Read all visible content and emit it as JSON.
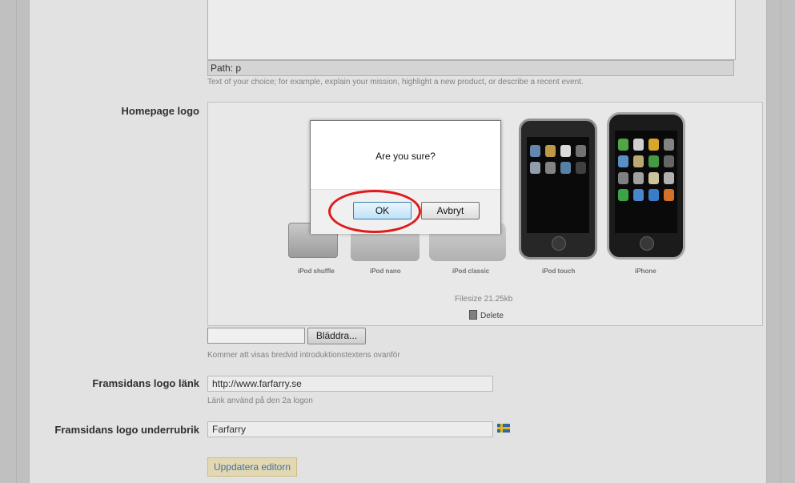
{
  "editor": {
    "path_text": "Path: p",
    "hint": "Text of your choice; for example, explain your mission, highlight a new product, or describe a recent event."
  },
  "homepage_logo": {
    "label": "Homepage logo",
    "device_labels": [
      "iPod shuffle",
      "iPod nano",
      "iPod classic",
      "iPod touch",
      "iPhone"
    ],
    "filesize": "Filesize 21.25kb",
    "delete_label": "Delete",
    "browse_label": "Bläddra...",
    "hint": "Kommer att visas bredvid introduktionstextens ovanför"
  },
  "logo_link": {
    "label": "Framsidans logo länk",
    "value": "http://www.farfarry.se",
    "hint": "Länk använd på den 2a logon"
  },
  "logo_subheading": {
    "label": "Framsidans logo underrubrik",
    "value": "Farfarry"
  },
  "update_button": "Uppdatera editorn",
  "dialog": {
    "message": "Are you sure?",
    "ok_label": "OK",
    "cancel_label": "Avbryt"
  },
  "colors": {
    "highlight_ring": "#e01b1b",
    "update_button_bg": "#f1e7c0"
  }
}
